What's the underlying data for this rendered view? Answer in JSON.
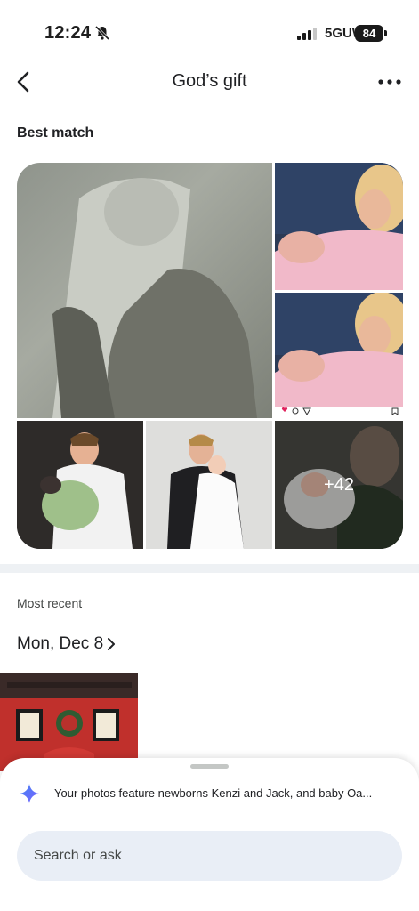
{
  "status": {
    "time": "12:24",
    "network": "5GUW",
    "battery": "84"
  },
  "header": {
    "title": "God’s gift"
  },
  "best_match": {
    "label": "Best match",
    "more_count": "+42"
  },
  "recent": {
    "label": "Most recent",
    "date": "Mon, Dec 8"
  },
  "sheet": {
    "summary": "Your photos feature newborns Kenzi and Jack, and baby Oa...",
    "search_placeholder": "Search or ask"
  },
  "icons": {
    "back": "back-arrow-icon",
    "more": "more-options-icon",
    "bell": "bell-muted-icon",
    "sparkle": "gemini-sparkle-icon",
    "chevron": "chevron-right-icon"
  }
}
